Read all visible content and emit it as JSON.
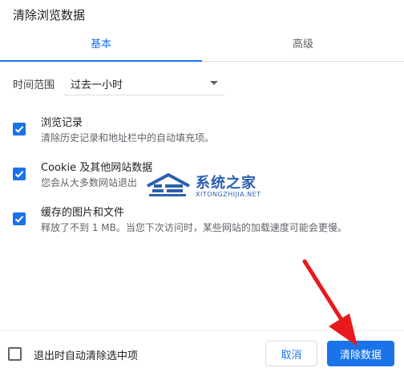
{
  "dialog": {
    "title": "清除浏览数据"
  },
  "tabs": [
    {
      "label": "基本",
      "active": true
    },
    {
      "label": "高级",
      "active": false
    }
  ],
  "time_range": {
    "label": "时间范围",
    "value": "过去一小时"
  },
  "items": [
    {
      "title": "浏览记录",
      "subtitle": "清除历史记录和地址栏中的自动填充项。",
      "checked": true
    },
    {
      "title": "Cookie 及其他网站数据",
      "subtitle": "您会从大多数网站退出",
      "checked": true
    },
    {
      "title": "缓存的图片和文件",
      "subtitle": "释放了不到 1 MB。当您下次访问时，某些网站的加载速度可能会更慢。",
      "checked": true
    }
  ],
  "watermark": {
    "cn": "系统之家",
    "en": "XITONGZHIJIA.NET"
  },
  "footer": {
    "auto_clear_label": "退出时自动清除选中项",
    "auto_clear_checked": false,
    "cancel_label": "取消",
    "clear_label": "清除数据"
  },
  "colors": {
    "accent": "#1a73e8",
    "arrow": "#e8191c",
    "watermark": "#2a5fb0"
  }
}
